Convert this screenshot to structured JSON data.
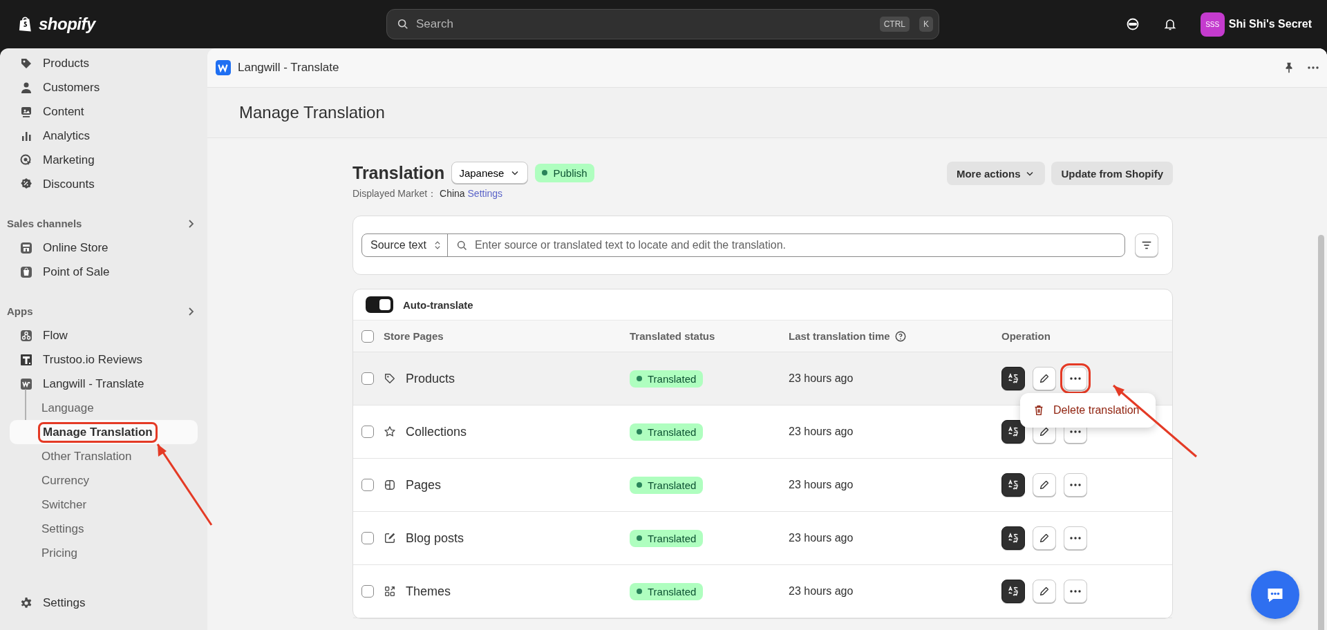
{
  "topbar": {
    "logo_text": "shopify",
    "search": {
      "placeholder": "Search",
      "keys": [
        "CTRL",
        "K"
      ]
    },
    "store": {
      "avatar": "SSS",
      "name": "Shi Shi's Secret"
    }
  },
  "sidebar": {
    "items": [
      {
        "label": "Products",
        "selected": false
      },
      {
        "label": "Customers",
        "selected": false
      },
      {
        "label": "Content",
        "selected": false
      },
      {
        "label": "Analytics",
        "selected": false
      },
      {
        "label": "Marketing",
        "selected": false
      },
      {
        "label": "Discounts",
        "selected": false
      }
    ],
    "sections": [
      {
        "title": "Sales channels",
        "items": [
          {
            "label": "Online Store",
            "selected": false
          },
          {
            "label": "Point of Sale",
            "selected": false
          }
        ]
      },
      {
        "title": "Apps",
        "items": [
          {
            "label": "Flow",
            "selected": false
          },
          {
            "label": "Trustoo.io Reviews",
            "selected": false
          },
          {
            "label": "Langwill - Translate",
            "selected": false,
            "children": [
              {
                "label": "Language",
                "selected": false
              },
              {
                "label": "Manage Translation",
                "selected": true,
                "callout": true
              },
              {
                "label": "Other Translation",
                "selected": false
              },
              {
                "label": "Currency",
                "selected": false
              },
              {
                "label": "Switcher",
                "selected": false
              },
              {
                "label": "Settings",
                "selected": false
              },
              {
                "label": "Pricing",
                "selected": false
              }
            ]
          }
        ]
      }
    ],
    "footer_item": {
      "label": "Settings",
      "selected": false
    }
  },
  "app_header": {
    "title": "Langwill - Translate"
  },
  "page_title": "Manage Translation",
  "translation": {
    "title": "Translation",
    "language": "Japanese",
    "status": "Publish",
    "market_label": "Displayed Market：",
    "market": "China",
    "settings_link": "Settings",
    "buttons": [
      "More actions",
      "Update from Shopify"
    ]
  },
  "search": {
    "scope": "Source text",
    "placeholder": "Enter source or translated text to locate and edit the translation."
  },
  "auto_translate": {
    "label": "Auto-translate",
    "on": true
  },
  "table": {
    "columns": [
      "Store Pages",
      "Translated status",
      "Last translation time",
      "Operation"
    ],
    "all_checked": false,
    "rows": [
      {
        "name": "Products",
        "status": "Translated",
        "time": "23 hours ago",
        "checked": false,
        "highlighted": true,
        "callout": true,
        "menu_items": [
          "Delete translation"
        ]
      },
      {
        "name": "Collections",
        "status": "Translated",
        "time": "23 hours ago",
        "checked": false,
        "highlighted": false
      },
      {
        "name": "Pages",
        "status": "Translated",
        "time": "23 hours ago",
        "checked": false,
        "highlighted": false
      },
      {
        "name": "Blog posts",
        "status": "Translated",
        "time": "23 hours ago",
        "checked": false,
        "highlighted": false
      },
      {
        "name": "Themes",
        "status": "Translated",
        "time": "23 hours ago",
        "checked": false,
        "highlighted": false
      }
    ]
  }
}
